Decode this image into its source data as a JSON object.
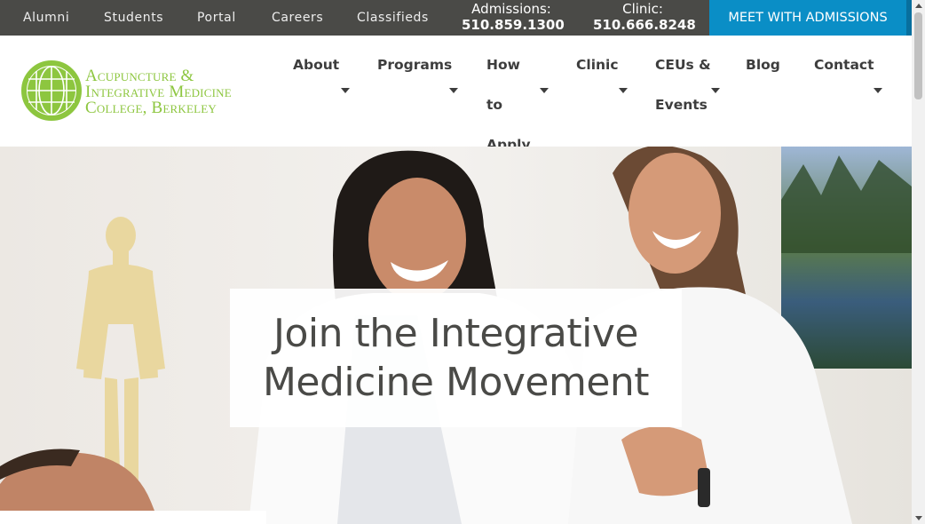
{
  "topbar": {
    "links": [
      "Alumni",
      "Students",
      "Portal",
      "Careers",
      "Classifieds"
    ],
    "admissions": {
      "label": "Admissions:",
      "number": "510.859.1300"
    },
    "clinic": {
      "label": "Clinic:",
      "number": "510.666.8248"
    },
    "cta": "MEET WITH ADMISSIONS"
  },
  "logo": {
    "lines": [
      "Acupuncture &",
      "Integrative Medicine",
      "College, Berkeley"
    ]
  },
  "nav": {
    "items": [
      {
        "label": "About"
      },
      {
        "label": "Programs"
      },
      {
        "label": "How to Apply",
        "lines": [
          "How",
          "to",
          "Apply"
        ]
      },
      {
        "label": "Clinic"
      },
      {
        "label": "CEUs & Events",
        "lines": [
          "CEUs &",
          "Events"
        ]
      },
      {
        "label": "Blog"
      },
      {
        "label": "Contact"
      }
    ]
  },
  "hero": {
    "title_line1": "Join the Integrative",
    "title_line2": "Medicine Movement"
  },
  "colors": {
    "topbar_bg": "#4a4a47",
    "cta_bg": "#0a8ec6",
    "logo_green": "#8dc63f",
    "nav_text": "#3d3d3d"
  },
  "icons": [
    "globe-logo-icon",
    "chevron-down-icon"
  ]
}
